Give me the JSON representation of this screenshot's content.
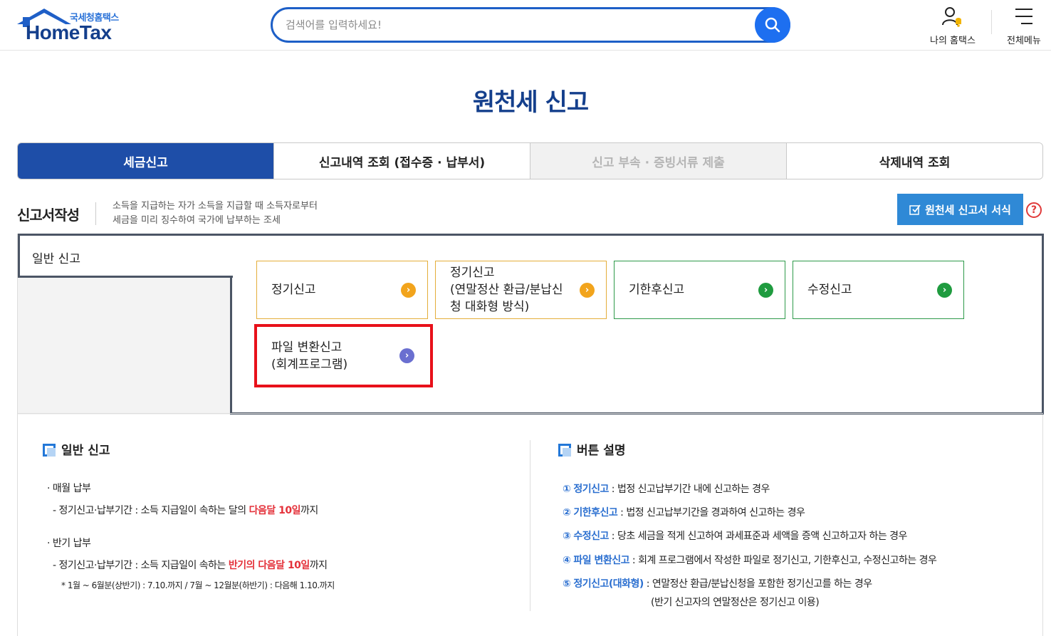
{
  "header": {
    "logo_sub": "국세청홈택스",
    "logo_main": "HomeTax",
    "search_placeholder": "검색어를 입력하세요!",
    "my_hometax": "나의 홈택스",
    "all_menu": "전체메뉴"
  },
  "page_title": "원천세 신고",
  "tabs": [
    {
      "label": "세금신고"
    },
    {
      "label": "신고내역 조회 (접수증 · 납부서)"
    },
    {
      "label": "신고 부속 · 증빙서류 제출"
    },
    {
      "label": "삭제내역 조회"
    }
  ],
  "section": {
    "title": "신고서작성",
    "desc_line1": "소득을 지급하는 자가 소득을 지급할 때 소득자로부터",
    "desc_line2": "세금을 미리 징수하여 국가에 납부하는 조세",
    "form_button": "원천세 신고서 서식",
    "help": "?"
  },
  "panel": {
    "label": "일반 신고",
    "options": [
      {
        "label": "정기신고"
      },
      {
        "label_lines": [
          "정기신고",
          "(연말정산 환급/분납신",
          "청 대화형 방식)"
        ]
      },
      {
        "label": "기한후신고"
      },
      {
        "label": "수정신고"
      },
      {
        "label_lines": [
          "파일 변환신고",
          "(회계프로그램)"
        ]
      }
    ]
  },
  "info_left": {
    "title": "일반 신고",
    "monthly_title": "· 매월 납부",
    "monthly_prefix": "- 정기신고·납부기간 : 소득 지급일이 속하는 달의 ",
    "monthly_red": "다음달 10일",
    "monthly_suffix": "까지",
    "half_title": "· 반기 납부",
    "half_prefix": "- 정기신고·납부기간 : 소득 지급일이 속하는 ",
    "half_red": "반기의 다음달 10일",
    "half_suffix": "까지",
    "half_note": "* 1월 ~ 6월분(상반기) : 7.10.까지 / 7월 ~ 12월분(하반기) : 다음해 1.10.까지"
  },
  "info_right": {
    "title": "버튼 설명",
    "items": [
      {
        "num": "①",
        "name": "정기신고",
        "desc": " : 법정 신고납부기간 내에 신고하는 경우"
      },
      {
        "num": "②",
        "name": "기한후신고",
        "desc": " : 법정 신고납부기간을 경과하여 신고하는 경우"
      },
      {
        "num": "③",
        "name": "수정신고",
        "desc": " : 당초 세금을 적게 신고하여 과세표준과 세액을 증액 신고하고자 하는 경우"
      },
      {
        "num": "④",
        "name": "파일 변환신고",
        "desc": " : 회계 프로그램에서 작성한 파일로 정기신고, 기한후신고, 수정신고하는 경우"
      },
      {
        "num": "⑤",
        "name": "정기신고(대화형)",
        "desc": " : 연말정산 환급/분납신청을 포함한 정기신고를 하는 경우"
      }
    ],
    "note": "(반기 신고자의 연말정산은 정기신고 이용)"
  },
  "colors": {
    "brand": "#143f8c",
    "tab_active": "#1e4ea8",
    "highlight": "#e8101a"
  }
}
